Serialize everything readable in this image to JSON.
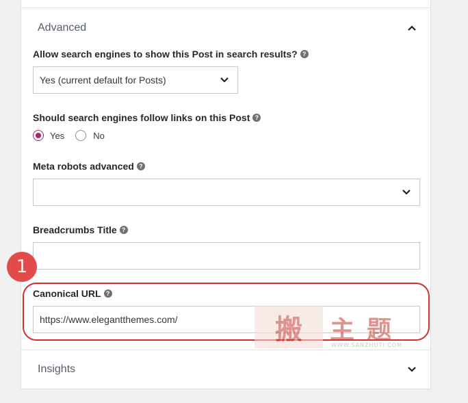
{
  "advanced": {
    "title": "Advanced",
    "allow_label": "Allow search engines to show this Post in search results?",
    "allow_select_value": "Yes (current default for Posts)",
    "follow_label": "Should search engines follow links on this Post",
    "follow_options": [
      "Yes",
      "No"
    ],
    "follow_selected": "Yes",
    "meta_robots_label": "Meta robots advanced",
    "meta_robots_value": "",
    "breadcrumbs_label": "Breadcrumbs Title",
    "breadcrumbs_value": "",
    "canonical_label": "Canonical URL",
    "canonical_value": "https://www.elegantthemes.com/"
  },
  "insights": {
    "title": "Insights"
  },
  "annotation": {
    "badge": "1",
    "highlight_color": "#d62b2b"
  },
  "watermark": {
    "seal": "搬",
    "text": "主题",
    "url": "WWW.SANZHUTI.COM"
  },
  "colors": {
    "accent": "#a4286a",
    "badge": "#e34b4b"
  }
}
